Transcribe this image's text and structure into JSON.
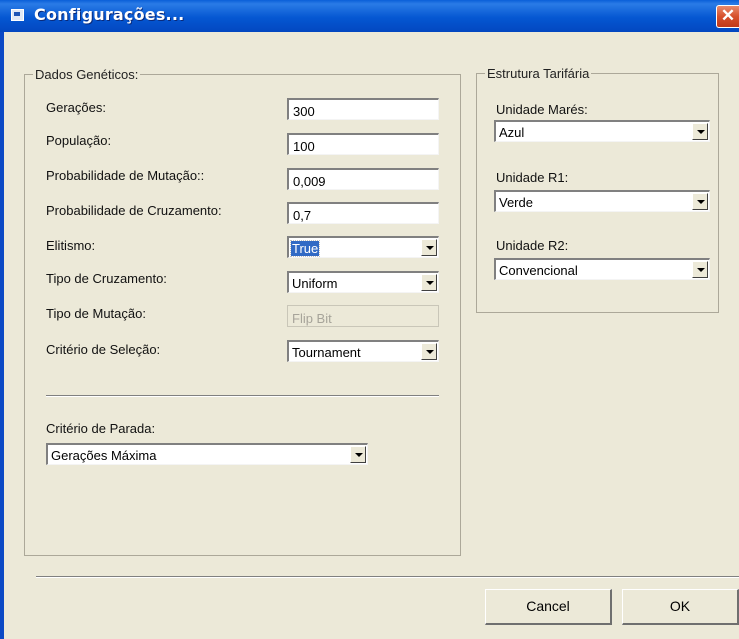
{
  "window": {
    "title": "Configurações...",
    "icon": "dialog-icon",
    "close_glyph": "✕"
  },
  "genetic": {
    "group_label": "Dados Genéticos:",
    "generations": {
      "label": "Gerações:",
      "value": "300"
    },
    "population": {
      "label": "População:",
      "value": "100"
    },
    "mutation_prob": {
      "label": "Probabilidade de  Mutação::",
      "value": "0,009"
    },
    "crossover_prob": {
      "label": "Probabilidade de  Cruzamento:",
      "value": "0,7"
    },
    "elitism": {
      "label": "Elitismo:",
      "value": "True"
    },
    "crossover_type": {
      "label": "Tipo de Cruzamento:",
      "value": "Uniform"
    },
    "mutation_type": {
      "label": "Tipo de Mutação:",
      "value": "Flip Bit"
    },
    "selection": {
      "label": "Critério de Seleção:",
      "value": "Tournament"
    },
    "stop": {
      "label": "Critério de Parada:",
      "value": "Gerações Máxima"
    }
  },
  "tariff": {
    "group_label": "Estrutura Tarifária",
    "mares": {
      "label": "Unidade Marés:",
      "value": "Azul"
    },
    "r1": {
      "label": "Unidade R1:",
      "value": "Verde"
    },
    "r2": {
      "label": "Unidade R2:",
      "value": "Convencional"
    }
  },
  "buttons": {
    "cancel": "Cancel",
    "ok": "OK"
  },
  "colors": {
    "titlebar": "#0557d2",
    "face": "#ece9d8",
    "selection": "#316ac5",
    "close": "#d7502c"
  }
}
